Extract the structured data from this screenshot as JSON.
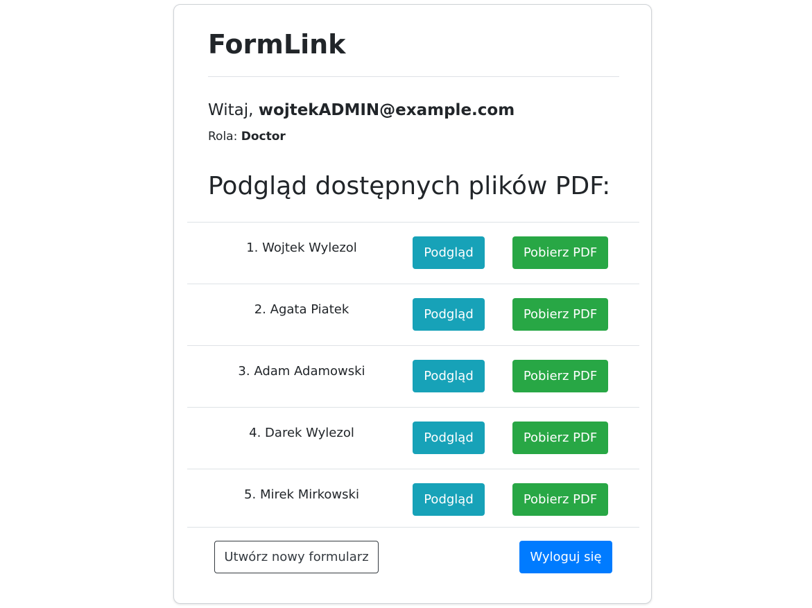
{
  "app": {
    "title": "FormLink"
  },
  "user": {
    "greeting_prefix": "Witaj, ",
    "email": "wojtekADMIN@example.com",
    "role_label": "Rola: ",
    "role": "Doctor"
  },
  "list": {
    "heading": "Podgląd dostępnych plików PDF:",
    "items": [
      {
        "name": "1. Wojtek Wylezol",
        "preview_label": "Podgląd",
        "download_label": "Pobierz PDF"
      },
      {
        "name": "2. Agata Piatek",
        "preview_label": "Podgląd",
        "download_label": "Pobierz PDF"
      },
      {
        "name": "3. Adam Adamowski",
        "preview_label": "Podgląd",
        "download_label": "Pobierz PDF"
      },
      {
        "name": "4. Darek Wylezol",
        "preview_label": "Podgląd",
        "download_label": "Pobierz PDF"
      },
      {
        "name": "5. Mirek Mirkowski",
        "preview_label": "Podgląd",
        "download_label": "Pobierz PDF"
      }
    ]
  },
  "footer": {
    "create_label": "Utwórz nowy formularz",
    "logout_label": "Wyloguj się"
  },
  "colors": {
    "preview_button": "#17a2b8",
    "download_button": "#28a745",
    "logout_button": "#007bff",
    "text": "#212529",
    "divider": "#dee2e6"
  }
}
